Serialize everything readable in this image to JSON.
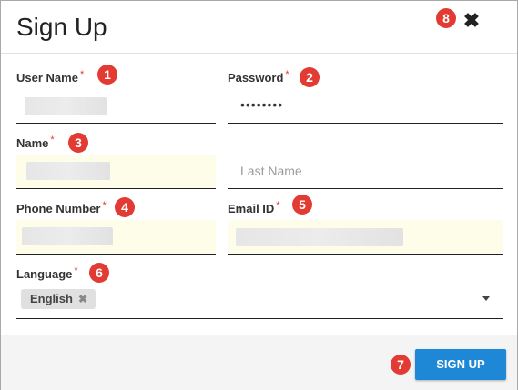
{
  "dialog": {
    "title": "Sign Up",
    "close_icon": "close-icon"
  },
  "colors": {
    "accent": "#1e88d6",
    "required": "#e53935",
    "marker": "#e23b33",
    "highlight_field": "#fdfde9"
  },
  "form": {
    "required_mark": "*",
    "user_name": {
      "label": "User Name",
      "value": ""
    },
    "password": {
      "label": "Password",
      "value": "••••••••"
    },
    "name": {
      "label": "Name",
      "first_value": "",
      "last_placeholder": "Last Name"
    },
    "phone": {
      "label": "Phone Number",
      "value": ""
    },
    "email": {
      "label": "Email ID",
      "value": ""
    },
    "language": {
      "label": "Language",
      "selected": [
        "English"
      ],
      "remove_glyph": "✖"
    }
  },
  "footer": {
    "signup_label": "SIGN UP"
  },
  "markers": [
    "1",
    "2",
    "3",
    "4",
    "5",
    "6",
    "7",
    "8"
  ]
}
